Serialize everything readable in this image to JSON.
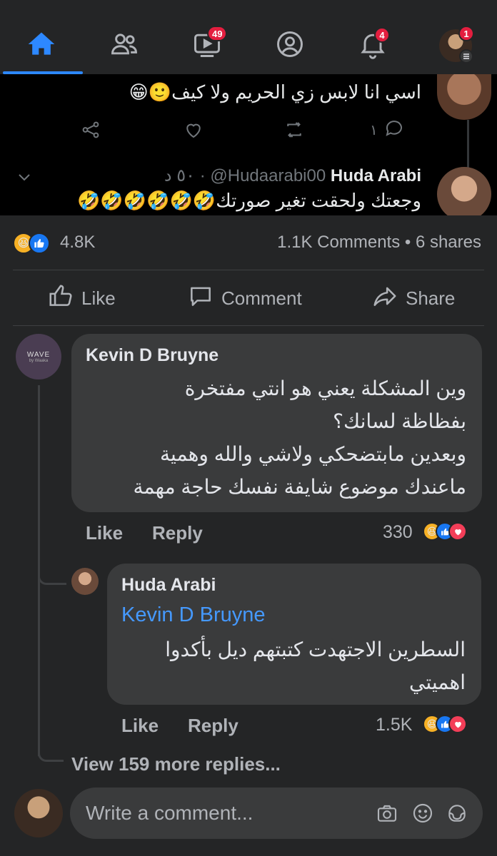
{
  "nav": {
    "video_badge": "49",
    "notifications_badge": "4",
    "menu_badge": "1",
    "icons": [
      "home-icon",
      "friends-icon",
      "watch-icon",
      "profile-icon",
      "notifications-icon",
      "menu-icon"
    ]
  },
  "embedded_post": {
    "reply1_text": "اسي انا لابس زي الحريم ولا كيف🙂😁",
    "reply1_reply_count": "١",
    "reply2_author_name": "Huda Arabi",
    "reply2_handle": "@Hudaarabi00",
    "reply2_time": "٥٠ د",
    "reply2_text": "وجعتك ولحقت تغير صورتك🤣🤣🤣🤣🤣🤣"
  },
  "reactions": {
    "count": "4.8K",
    "comments_shares": "1.1K Comments • 6 shares"
  },
  "actions": {
    "like": "Like",
    "comment": "Comment",
    "share": "Share"
  },
  "comments": [
    {
      "author": "Kevin D Bruyne",
      "avatar_text": "WAVE",
      "avatar_subtext": "by Waaka",
      "text_lines": [
        "وين المشكلة يعني هو انتي مفتخرة",
        "بفظاظة لسانك؟",
        "وبعدين مابتضحكي ولاشي والله وهمية",
        "ماعندك موضوع شايفة نفسك حاجة مهمة"
      ],
      "like": "Like",
      "reply": "Reply",
      "reaction_count": "330"
    },
    {
      "author": "Huda Arabi",
      "mention": "Kevin D Bruyne",
      "text_lines": [
        "السطرين الاجتهدت كتبتهم ديل بأكدوا",
        "اهميتي"
      ],
      "like": "Like",
      "reply": "Reply",
      "reaction_count": "1.5K"
    }
  ],
  "view_more": "View 159 more replies...",
  "composer": {
    "placeholder": "Write a comment..."
  },
  "colors": {
    "background": "#242526",
    "bubble": "#3a3b3c",
    "accent": "#2d88ff",
    "badge": "#e41e3f",
    "mention": "#4599ff"
  }
}
